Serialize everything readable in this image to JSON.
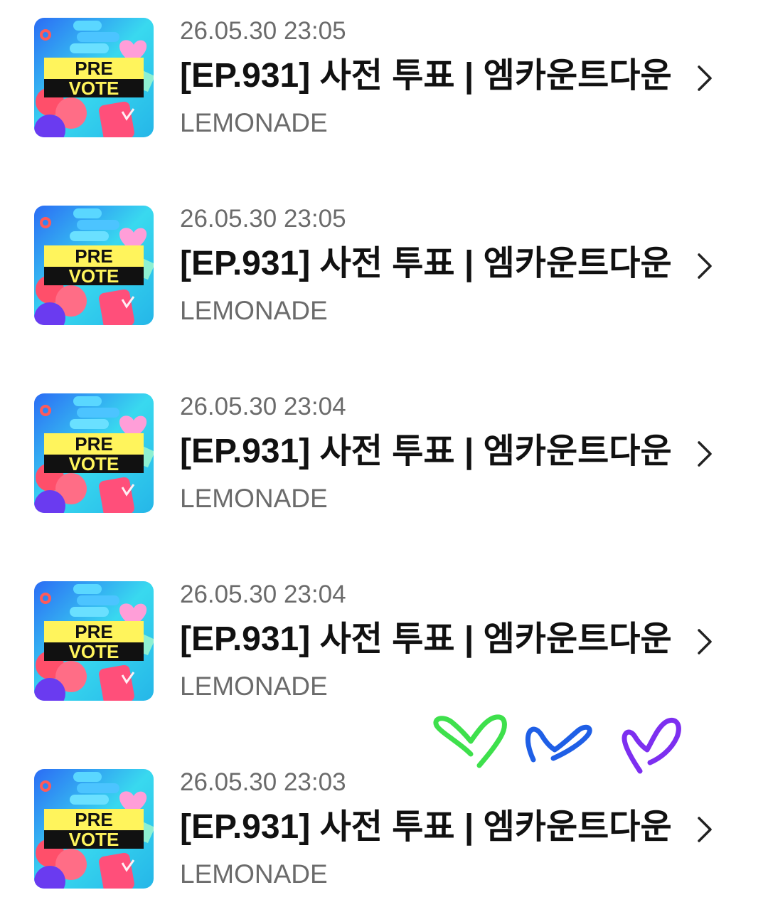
{
  "items": [
    {
      "date": "26.05.30 23:05",
      "title": "[EP.931] 사전 투표 | 엠카운트다운",
      "artist": "LEMONADE",
      "thumb": {
        "line1": "PRE",
        "line2": "VOTE"
      }
    },
    {
      "date": "26.05.30 23:05",
      "title": "[EP.931] 사전 투표 | 엠카운트다운",
      "artist": "LEMONADE",
      "thumb": {
        "line1": "PRE",
        "line2": "VOTE"
      }
    },
    {
      "date": "26.05.30 23:04",
      "title": "[EP.931] 사전 투표 | 엠카운트다운",
      "artist": "LEMONADE",
      "thumb": {
        "line1": "PRE",
        "line2": "VOTE"
      }
    },
    {
      "date": "26.05.30 23:04",
      "title": "[EP.931] 사전 투표 | 엠카운트다운",
      "artist": "LEMONADE",
      "thumb": {
        "line1": "PRE",
        "line2": "VOTE"
      }
    },
    {
      "date": "26.05.30 23:03",
      "title": "[EP.931] 사전 투표 | 엠카운트다운",
      "artist": "LEMONADE",
      "thumb": {
        "line1": "PRE",
        "line2": "VOTE"
      }
    }
  ],
  "icons": {
    "chevron": "chevron-right-icon",
    "thumbnail": "pre-vote-thumbnail"
  },
  "doodle": {
    "hearts": [
      {
        "name": "green-heart-doodle",
        "color": "#3ee04c"
      },
      {
        "name": "blue-heart-doodle",
        "color": "#1f5fe6"
      },
      {
        "name": "purple-heart-doodle",
        "color": "#7d2ff0"
      }
    ]
  },
  "colors": {
    "date": "#6b6b6b",
    "title": "#111111",
    "artist": "#6b6b6b",
    "thumb_bg": "#3ad7f0",
    "thumb_banner": "#fff45c"
  }
}
